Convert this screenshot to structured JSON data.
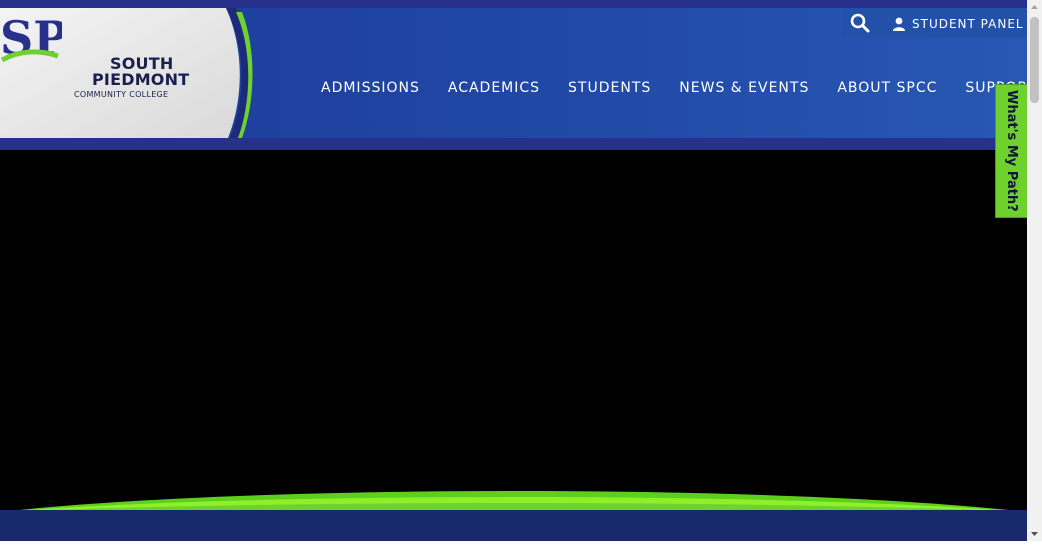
{
  "logo": {
    "letters": "SP",
    "line1": "SOUTH",
    "line2": "PIEDMONT",
    "line3": "COMMUNITY COLLEGE"
  },
  "utility": {
    "search_icon": "search-icon",
    "user_icon": "user-icon",
    "student_panel_label": "STUDENT PANEL"
  },
  "nav": {
    "items": [
      {
        "label": "ADMISSIONS"
      },
      {
        "label": "ACADEMICS"
      },
      {
        "label": "STUDENTS"
      },
      {
        "label": "NEWS & EVENTS"
      },
      {
        "label": "ABOUT SPCC"
      },
      {
        "label": "SUPPORT SPCC"
      }
    ]
  },
  "side_tab": {
    "label": "What's My Path?"
  },
  "colors": {
    "brand_blue": "#2047a4",
    "dark_blue": "#27318b",
    "accent_green": "#6ed12e",
    "hero_bg": "#000000"
  }
}
